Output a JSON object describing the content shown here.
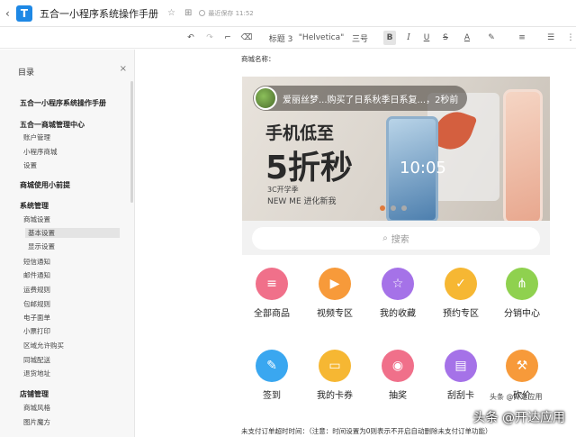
{
  "header": {
    "doc_title": "五合一小程序系统操作手册",
    "saved_status": "最近保存 11:52"
  },
  "toolbar": {
    "heading": "标题 3",
    "font": "\"Helvetica\"",
    "size": "三号",
    "bold": "B",
    "italic": "I",
    "underline": "U",
    "strike": "S",
    "font_color": "A"
  },
  "sidebar": {
    "title": "目录",
    "items": [
      {
        "label": "五合一小程序系统操作手册",
        "level": "h1"
      },
      {
        "label": "五合一商城管理中心",
        "level": "h1"
      },
      {
        "label": "账户管理",
        "level": "h2"
      },
      {
        "label": "小程序商城",
        "level": "h2"
      },
      {
        "label": "设置",
        "level": "h2"
      },
      {
        "label": "商城使用小前提",
        "level": "h1"
      },
      {
        "label": "系统管理",
        "level": "h1"
      },
      {
        "label": "商城设置",
        "level": "h2"
      },
      {
        "label": "基本设置",
        "level": "h3",
        "selected": true
      },
      {
        "label": "显示设置",
        "level": "h3"
      },
      {
        "label": "短信通知",
        "level": "h2"
      },
      {
        "label": "邮件通知",
        "level": "h2"
      },
      {
        "label": "运费规则",
        "level": "h2"
      },
      {
        "label": "包邮规则",
        "level": "h2"
      },
      {
        "label": "电子面单",
        "level": "h2"
      },
      {
        "label": "小票打印",
        "level": "h2"
      },
      {
        "label": "区域允许购买",
        "level": "h2"
      },
      {
        "label": "同城配送",
        "level": "h2"
      },
      {
        "label": "退货地址",
        "level": "h2"
      },
      {
        "label": "店铺管理",
        "level": "h1"
      },
      {
        "label": "商城风格",
        "level": "h2"
      },
      {
        "label": "图片魔方",
        "level": "h2"
      }
    ]
  },
  "content": {
    "label_top": "商城名称：",
    "notice": "爱丽丝梦...购买了日系秋季日系复...，2秒前",
    "promo_line1": "手机低至",
    "promo_line2": "5折秒",
    "promo_line3": "3C开学季",
    "promo_line4": "NEW ME 进化新我",
    "phone_clock": "10:05",
    "search_placeholder": "搜索",
    "grid": [
      {
        "label": "全部商品",
        "icon": "layers-icon",
        "glyph": "≡",
        "color": "#f0708a"
      },
      {
        "label": "视频专区",
        "icon": "video-icon",
        "glyph": "▶",
        "color": "#f79a3a"
      },
      {
        "label": "我的收藏",
        "icon": "star-icon",
        "glyph": "☆",
        "color": "#a572e8"
      },
      {
        "label": "预约专区",
        "icon": "calendar-check-icon",
        "glyph": "✓",
        "color": "#f6b733"
      },
      {
        "label": "分销中心",
        "icon": "network-icon",
        "glyph": "⋔",
        "color": "#8fd14f"
      },
      {
        "label": "签到",
        "icon": "pen-icon",
        "glyph": "✎",
        "color": "#3aa7f0"
      },
      {
        "label": "我的卡券",
        "icon": "card-icon",
        "glyph": "▭",
        "color": "#f6b733"
      },
      {
        "label": "抽奖",
        "icon": "lottery-icon",
        "glyph": "◉",
        "color": "#f0708a"
      },
      {
        "label": "刮刮卡",
        "icon": "scratch-card-icon",
        "glyph": "▤",
        "color": "#a572e8"
      },
      {
        "label": "砍价",
        "icon": "hammer-icon",
        "glyph": "⚒",
        "color": "#f79a3a"
      }
    ],
    "bottom_note": "未支付订单超时时间：（注意：时间设置为0则表示不开启自动删除未支付订单功能）",
    "watermark_small": "头条 @开达应用",
    "watermark": "头条 @开达应用"
  }
}
